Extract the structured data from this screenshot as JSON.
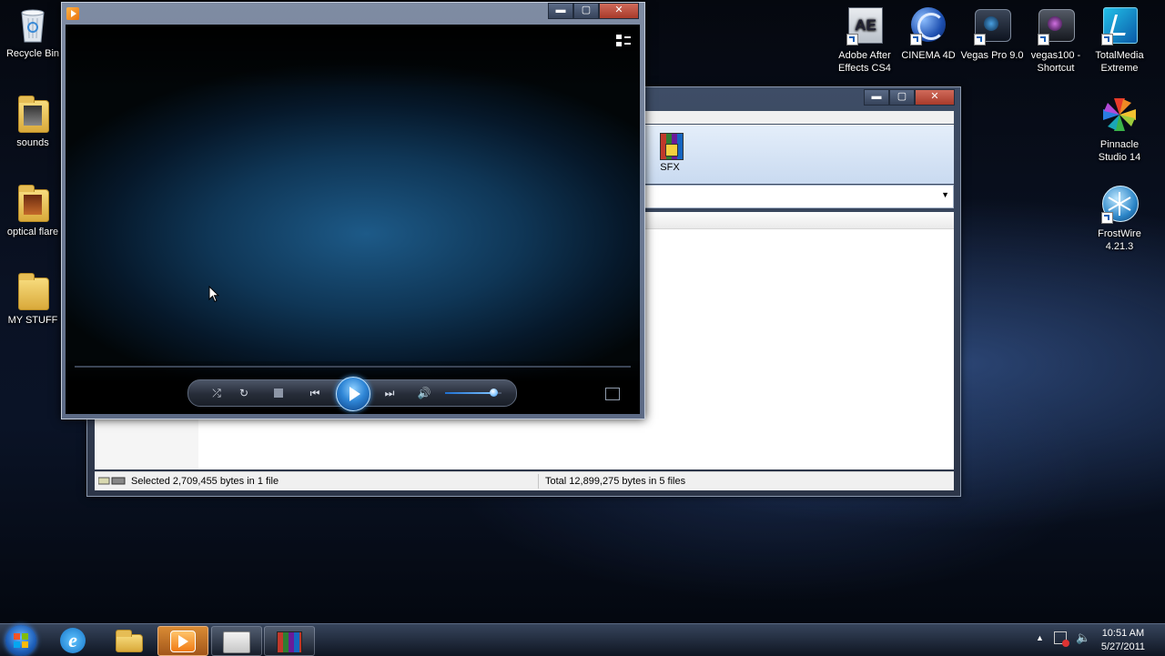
{
  "desktop": {
    "left_icons": [
      {
        "label": "Recycle Bin",
        "icon": "recycle-bin-icon"
      },
      {
        "label": "sounds",
        "icon": "folder-icon"
      },
      {
        "label": "optical flare",
        "icon": "folder-icon"
      },
      {
        "label": "MY STUFF",
        "icon": "folder-icon"
      }
    ],
    "right_icons": [
      {
        "label": "Adobe After Effects CS4",
        "icon": "after-effects-icon",
        "tile_text": "AE"
      },
      {
        "label": "CINEMA 4D",
        "icon": "cinema4d-icon"
      },
      {
        "label": "Vegas Pro 9.0",
        "icon": "vegas-pro-icon"
      },
      {
        "label": "vegas100 - Shortcut",
        "icon": "vegas-shortcut-icon"
      },
      {
        "label": "TotalMedia Extreme",
        "icon": "totalmedia-icon"
      },
      {
        "label": "Pinnacle Studio 14",
        "icon": "pinnacle-icon"
      },
      {
        "label": "FrostWire 4.21.3",
        "icon": "frostwire-icon"
      }
    ]
  },
  "archive_window": {
    "toolbar": {
      "sfx_label": "SFX"
    },
    "status": {
      "selected": "Selected 2,709,455 bytes in 1 file",
      "total": "Total 12,899,275 bytes in 5 files"
    }
  },
  "media_player": {
    "controls": [
      "shuffle",
      "repeat",
      "stop",
      "previous",
      "play",
      "next",
      "mute",
      "volume",
      "fullscreen"
    ],
    "volume_level": 0.85,
    "accent": "#2f86d6"
  },
  "window_buttons": {
    "minimize": "▬",
    "maximize": "▢",
    "close": "✕"
  },
  "taskbar": {
    "pinned": [
      "internet-explorer-icon",
      "explorer-icon",
      "media-player-icon",
      "slideshow-icon",
      "winrar-icon"
    ],
    "clock": {
      "time": "10:51 AM",
      "date": "5/27/2011"
    }
  }
}
